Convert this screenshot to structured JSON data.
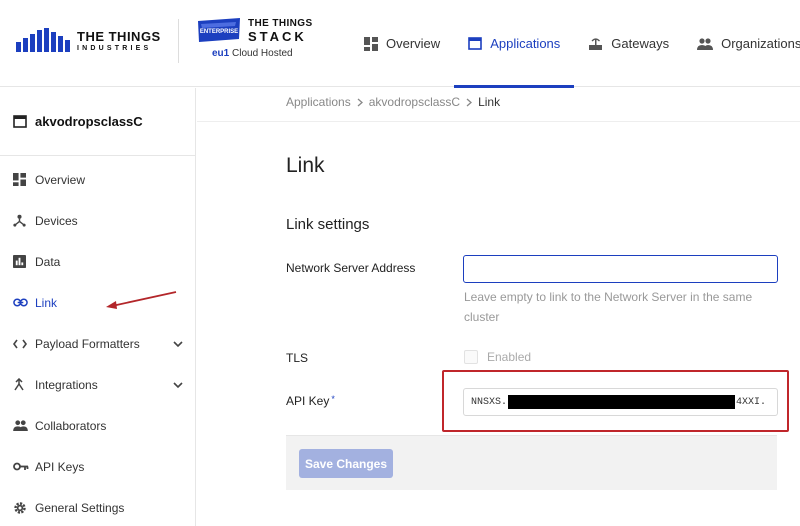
{
  "header": {
    "tti_logo": {
      "line1": "THE THINGS",
      "line2": "INDUSTRIES"
    },
    "stack_logo": {
      "badge": "ENTERPRISE",
      "line1": "THE THINGS",
      "line2": "STACK",
      "region": "eu1",
      "hosted": "Cloud Hosted"
    },
    "nav": [
      {
        "label": "Overview",
        "icon": "dashboard-icon"
      },
      {
        "label": "Applications",
        "icon": "window-icon",
        "active": true
      },
      {
        "label": "Gateways",
        "icon": "router-icon"
      },
      {
        "label": "Organizations",
        "icon": "people-icon"
      }
    ]
  },
  "sidebar": {
    "app_name": "akvodropsclassC",
    "items": [
      {
        "label": "Overview",
        "icon": "dashboard-icon"
      },
      {
        "label": "Devices",
        "icon": "device-hub-icon"
      },
      {
        "label": "Data",
        "icon": "bar-chart-icon"
      },
      {
        "label": "Link",
        "icon": "link-icon",
        "active": true
      },
      {
        "label": "Payload Formatters",
        "icon": "code-icon",
        "expandable": true
      },
      {
        "label": "Integrations",
        "icon": "merge-icon",
        "expandable": true
      },
      {
        "label": "Collaborators",
        "icon": "people-icon"
      },
      {
        "label": "API Keys",
        "icon": "key-icon"
      },
      {
        "label": "General Settings",
        "icon": "gear-icon"
      }
    ]
  },
  "breadcrumb": [
    "Applications",
    "akvodropsclassC",
    "Link"
  ],
  "page": {
    "title": "Link",
    "section_title": "Link settings",
    "fields": {
      "network_server_address": {
        "label": "Network Server Address",
        "value": "",
        "placeholder": "",
        "hint": "Leave empty to link to the Network Server in the same cluster"
      },
      "tls": {
        "label": "TLS",
        "checkbox_label": "Enabled",
        "checked": false
      },
      "api_key": {
        "label": "API Key",
        "required_mark": "*",
        "value_prefix": "NNSXS.",
        "value_suffix": "4XXI."
      }
    },
    "save_label": "Save Changes"
  },
  "colors": {
    "brand_blue": "#1c3fbf",
    "highlight_red": "#c0262b",
    "save_button_disabled": "#a3b1e0"
  }
}
